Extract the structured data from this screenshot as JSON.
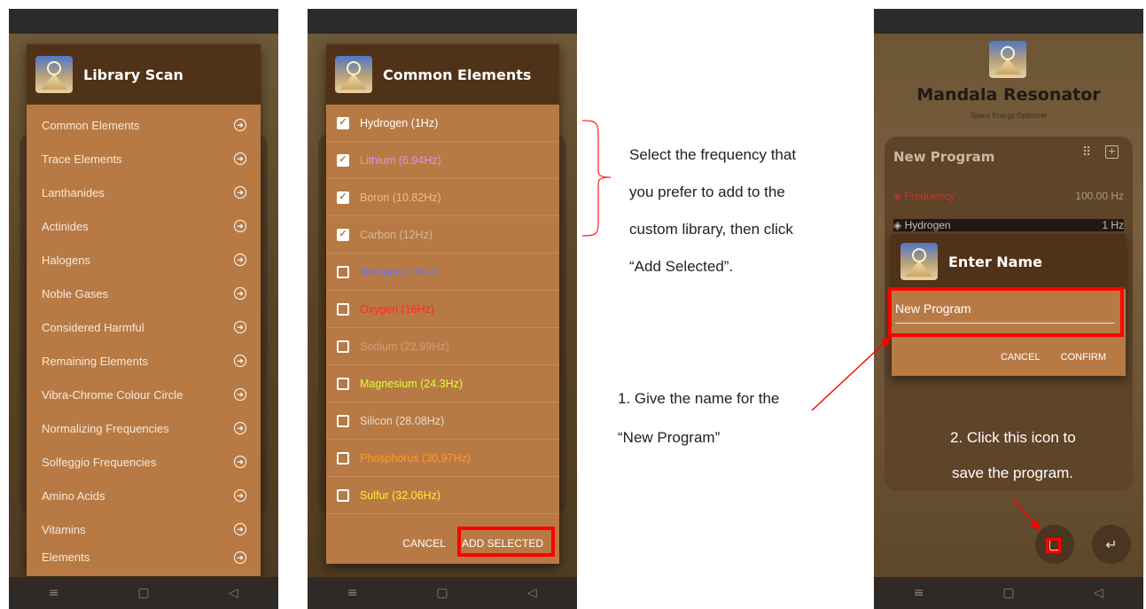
{
  "library_scan": {
    "title": "Library Scan",
    "items": [
      {
        "label": "Common Elements"
      },
      {
        "label": "Trace Elements"
      },
      {
        "label": "Lanthanides"
      },
      {
        "label": "Actinides"
      },
      {
        "label": "Halogens"
      },
      {
        "label": "Noble Gases"
      },
      {
        "label": "Considered Harmful"
      },
      {
        "label": "Remaining Elements"
      },
      {
        "label": "Vibra-Chrome Colour Circle"
      },
      {
        "label": "Normalizing Frequencies"
      },
      {
        "label": "Solfeggio Frequencies"
      },
      {
        "label": "Amino Acids"
      },
      {
        "label": "Vitamins"
      },
      {
        "label": "Elements"
      }
    ]
  },
  "common_elements": {
    "title": "Common Elements",
    "items": [
      {
        "label": "Hydrogen (1Hz)",
        "checked": true,
        "color": "#ffffff"
      },
      {
        "label": "Lithium (6.94Hz)",
        "checked": true,
        "color": "#e28ee0"
      },
      {
        "label": "Boron (10.82Hz)",
        "checked": true,
        "color": "#f1b98a"
      },
      {
        "label": "Carbon (12Hz)",
        "checked": true,
        "color": "#d3b89a"
      },
      {
        "label": "Nitrogen (14Hz)",
        "checked": false,
        "color": "#6f74e6"
      },
      {
        "label": "Oxygen (16Hz)",
        "checked": false,
        "color": "#ff2a2a"
      },
      {
        "label": "Sodium (22.99Hz)",
        "checked": false,
        "color": "#d49a7a"
      },
      {
        "label": "Magnesium (24.3Hz)",
        "checked": false,
        "color": "#d9ff3a"
      },
      {
        "label": "Silicon (28.08Hz)",
        "checked": false,
        "color": "#eadbc9"
      },
      {
        "label": "Phosphorus (30.97Hz)",
        "checked": false,
        "color": "#ff9a2a"
      },
      {
        "label": "Sulfur (32.06Hz)",
        "checked": false,
        "color": "#ffee33"
      }
    ],
    "cancel_label": "CANCEL",
    "add_selected_label": "ADD SELECTED"
  },
  "annotations": {
    "select_lines": [
      "Select the frequency that",
      "you prefer to add to the",
      "custom library, then click",
      "“Add Selected”."
    ],
    "step1_lines": [
      "1. Give the name for the",
      "“New Program”"
    ],
    "step2_lines": [
      "2. Click this icon to",
      "save the program."
    ]
  },
  "resonator": {
    "app_title": "Mandala Resonator",
    "subtitle": "Space Energy Optimizer",
    "program_title": "New Program",
    "frequency_label": "Frequency",
    "frequency_value": "100.00 Hz",
    "element_label": "Hydrogen",
    "element_value": "1 Hz",
    "dialog_title": "Enter Name",
    "name_value": "New Program",
    "cancel_label": "CANCEL",
    "confirm_label": "CONFIRM"
  },
  "nav": {
    "menu_icon": "≡",
    "home_icon": "▢",
    "back_icon": "◁"
  },
  "colors": {
    "dialog_bg": "#b87a44",
    "header_bg": "#4f3217",
    "highlight": "#ff0000"
  }
}
